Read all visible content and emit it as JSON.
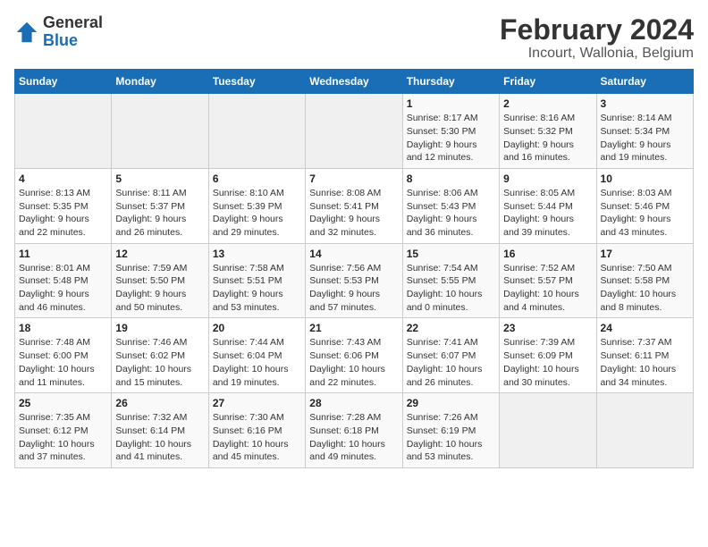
{
  "header": {
    "logo_general": "General",
    "logo_blue": "Blue",
    "title": "February 2024",
    "subtitle": "Incourt, Wallonia, Belgium"
  },
  "weekdays": [
    "Sunday",
    "Monday",
    "Tuesday",
    "Wednesday",
    "Thursday",
    "Friday",
    "Saturday"
  ],
  "weeks": [
    [
      {
        "day": "",
        "details": ""
      },
      {
        "day": "",
        "details": ""
      },
      {
        "day": "",
        "details": ""
      },
      {
        "day": "",
        "details": ""
      },
      {
        "day": "1",
        "details": "Sunrise: 8:17 AM\nSunset: 5:30 PM\nDaylight: 9 hours\nand 12 minutes."
      },
      {
        "day": "2",
        "details": "Sunrise: 8:16 AM\nSunset: 5:32 PM\nDaylight: 9 hours\nand 16 minutes."
      },
      {
        "day": "3",
        "details": "Sunrise: 8:14 AM\nSunset: 5:34 PM\nDaylight: 9 hours\nand 19 minutes."
      }
    ],
    [
      {
        "day": "4",
        "details": "Sunrise: 8:13 AM\nSunset: 5:35 PM\nDaylight: 9 hours\nand 22 minutes."
      },
      {
        "day": "5",
        "details": "Sunrise: 8:11 AM\nSunset: 5:37 PM\nDaylight: 9 hours\nand 26 minutes."
      },
      {
        "day": "6",
        "details": "Sunrise: 8:10 AM\nSunset: 5:39 PM\nDaylight: 9 hours\nand 29 minutes."
      },
      {
        "day": "7",
        "details": "Sunrise: 8:08 AM\nSunset: 5:41 PM\nDaylight: 9 hours\nand 32 minutes."
      },
      {
        "day": "8",
        "details": "Sunrise: 8:06 AM\nSunset: 5:43 PM\nDaylight: 9 hours\nand 36 minutes."
      },
      {
        "day": "9",
        "details": "Sunrise: 8:05 AM\nSunset: 5:44 PM\nDaylight: 9 hours\nand 39 minutes."
      },
      {
        "day": "10",
        "details": "Sunrise: 8:03 AM\nSunset: 5:46 PM\nDaylight: 9 hours\nand 43 minutes."
      }
    ],
    [
      {
        "day": "11",
        "details": "Sunrise: 8:01 AM\nSunset: 5:48 PM\nDaylight: 9 hours\nand 46 minutes."
      },
      {
        "day": "12",
        "details": "Sunrise: 7:59 AM\nSunset: 5:50 PM\nDaylight: 9 hours\nand 50 minutes."
      },
      {
        "day": "13",
        "details": "Sunrise: 7:58 AM\nSunset: 5:51 PM\nDaylight: 9 hours\nand 53 minutes."
      },
      {
        "day": "14",
        "details": "Sunrise: 7:56 AM\nSunset: 5:53 PM\nDaylight: 9 hours\nand 57 minutes."
      },
      {
        "day": "15",
        "details": "Sunrise: 7:54 AM\nSunset: 5:55 PM\nDaylight: 10 hours\nand 0 minutes."
      },
      {
        "day": "16",
        "details": "Sunrise: 7:52 AM\nSunset: 5:57 PM\nDaylight: 10 hours\nand 4 minutes."
      },
      {
        "day": "17",
        "details": "Sunrise: 7:50 AM\nSunset: 5:58 PM\nDaylight: 10 hours\nand 8 minutes."
      }
    ],
    [
      {
        "day": "18",
        "details": "Sunrise: 7:48 AM\nSunset: 6:00 PM\nDaylight: 10 hours\nand 11 minutes."
      },
      {
        "day": "19",
        "details": "Sunrise: 7:46 AM\nSunset: 6:02 PM\nDaylight: 10 hours\nand 15 minutes."
      },
      {
        "day": "20",
        "details": "Sunrise: 7:44 AM\nSunset: 6:04 PM\nDaylight: 10 hours\nand 19 minutes."
      },
      {
        "day": "21",
        "details": "Sunrise: 7:43 AM\nSunset: 6:06 PM\nDaylight: 10 hours\nand 22 minutes."
      },
      {
        "day": "22",
        "details": "Sunrise: 7:41 AM\nSunset: 6:07 PM\nDaylight: 10 hours\nand 26 minutes."
      },
      {
        "day": "23",
        "details": "Sunrise: 7:39 AM\nSunset: 6:09 PM\nDaylight: 10 hours\nand 30 minutes."
      },
      {
        "day": "24",
        "details": "Sunrise: 7:37 AM\nSunset: 6:11 PM\nDaylight: 10 hours\nand 34 minutes."
      }
    ],
    [
      {
        "day": "25",
        "details": "Sunrise: 7:35 AM\nSunset: 6:12 PM\nDaylight: 10 hours\nand 37 minutes."
      },
      {
        "day": "26",
        "details": "Sunrise: 7:32 AM\nSunset: 6:14 PM\nDaylight: 10 hours\nand 41 minutes."
      },
      {
        "day": "27",
        "details": "Sunrise: 7:30 AM\nSunset: 6:16 PM\nDaylight: 10 hours\nand 45 minutes."
      },
      {
        "day": "28",
        "details": "Sunrise: 7:28 AM\nSunset: 6:18 PM\nDaylight: 10 hours\nand 49 minutes."
      },
      {
        "day": "29",
        "details": "Sunrise: 7:26 AM\nSunset: 6:19 PM\nDaylight: 10 hours\nand 53 minutes."
      },
      {
        "day": "",
        "details": ""
      },
      {
        "day": "",
        "details": ""
      }
    ]
  ]
}
